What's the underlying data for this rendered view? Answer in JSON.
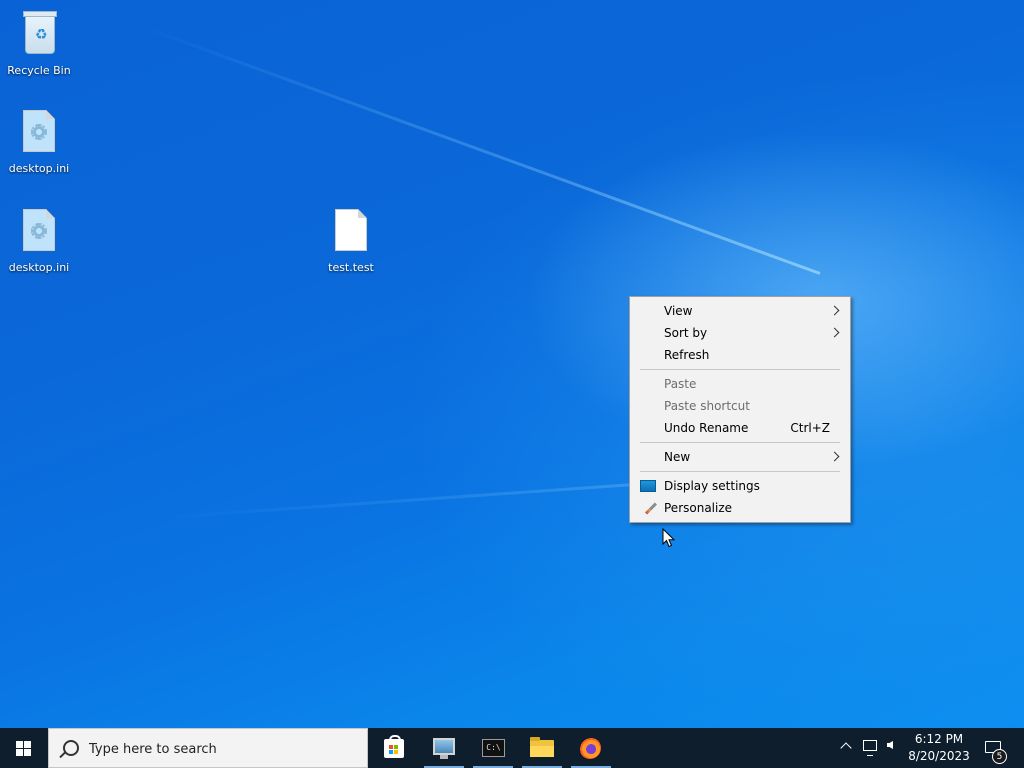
{
  "desktop": {
    "icons": [
      {
        "label": "Recycle Bin",
        "icon": "recycle-bin-icon"
      },
      {
        "label": "desktop.ini",
        "icon": "settings-file-icon"
      },
      {
        "label": "desktop.ini",
        "icon": "settings-file-icon"
      },
      {
        "label": "test.test",
        "icon": "blank-file-icon"
      }
    ]
  },
  "context_menu": {
    "items": {
      "view": {
        "label": "View",
        "submenu": true
      },
      "sort_by": {
        "label": "Sort by",
        "submenu": true
      },
      "refresh": {
        "label": "Refresh"
      },
      "paste": {
        "label": "Paste",
        "disabled": true
      },
      "paste_shortcut": {
        "label": "Paste shortcut",
        "disabled": true
      },
      "undo_rename": {
        "label": "Undo Rename",
        "shortcut": "Ctrl+Z"
      },
      "new": {
        "label": "New",
        "submenu": true
      },
      "display_settings": {
        "label": "Display settings",
        "icon": "monitor-icon"
      },
      "personalize": {
        "label": "Personalize",
        "icon": "paintbrush-icon"
      }
    }
  },
  "taskbar": {
    "search_placeholder": "Type here to search",
    "apps": [
      "microsoft-store",
      "remote-desktop",
      "command-prompt",
      "file-explorer",
      "firefox"
    ],
    "cmd_glyph": "C:\\",
    "clock": {
      "time": "6:12 PM",
      "date": "8/20/2023"
    },
    "notification_count": "5"
  },
  "colors": {
    "taskbar_bg": "#0f1e2d",
    "menu_bg": "#f2f2f2",
    "desktop_blue": "#0a63d6"
  }
}
